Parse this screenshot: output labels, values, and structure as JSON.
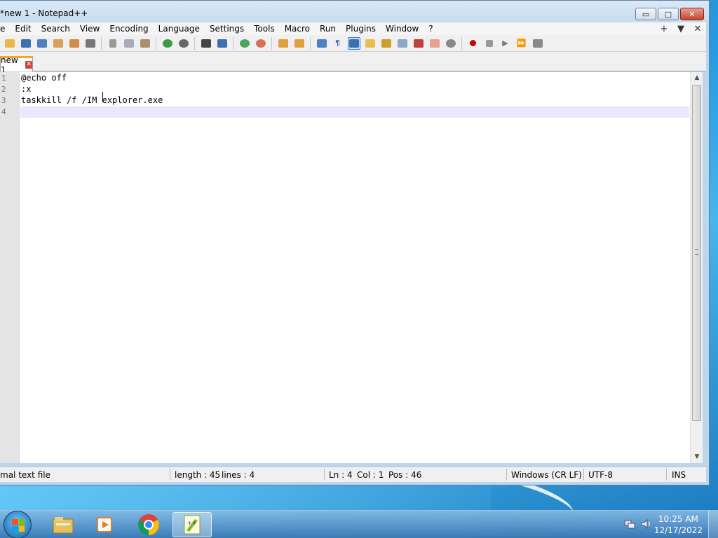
{
  "window": {
    "title": "*new 1 - Notepad++",
    "controls": {
      "minimize": "▭",
      "maximize": "□",
      "close": "✕"
    }
  },
  "menubar": {
    "items": [
      "e",
      "Edit",
      "Search",
      "View",
      "Encoding",
      "Language",
      "Settings",
      "Tools",
      "Macro",
      "Run",
      "Plugins",
      "Window",
      "?"
    ],
    "right": {
      "add": "+",
      "dropdown": "▼",
      "close": "✕"
    }
  },
  "toolbar": {
    "icons": [
      "open-icon",
      "save-icon",
      "save-all-icon",
      "close-icon",
      "close-all-icon",
      "print-icon",
      "cut-icon",
      "copy-icon",
      "paste-icon",
      "undo-icon",
      "redo-icon",
      "find-icon",
      "replace-icon",
      "zoom-in-icon",
      "zoom-out-icon",
      "sync-vertical-icon",
      "sync-horizontal-icon",
      "word-wrap-icon",
      "show-all-chars-icon",
      "indent-guide-icon",
      "user-lang-icon",
      "doc-map-icon",
      "function-list-icon",
      "folder-workspace-icon",
      "monitoring-icon",
      "record-macro-icon",
      "stop-record-icon",
      "play-macro-icon",
      "run-macro-multiple-icon",
      "save-macro-icon"
    ],
    "active": "indent-guide-icon"
  },
  "tab": {
    "label": "new 1",
    "close": "✕"
  },
  "editor": {
    "line_numbers": [
      "1",
      "2",
      "3",
      "4"
    ],
    "lines": [
      "@echo off",
      ":x",
      "taskkill /f /IM explorer.exe",
      ""
    ]
  },
  "statusbar": {
    "file_type": "mal text file",
    "length": "length : 45",
    "lines": "lines : 4",
    "ln": "Ln : 4",
    "col": "Col : 1",
    "pos": "Pos : 46",
    "eol": "Windows (CR LF)",
    "encoding": "UTF-8",
    "mode": "INS"
  },
  "taskbar": {
    "apps": [
      "windows-explorer-icon",
      "media-player-icon",
      "chrome-icon",
      "notepad-plus-plus-icon"
    ],
    "active_app": "notepad-plus-plus-icon",
    "clock": {
      "time": "10:25 AM",
      "date": "12/17/2022"
    }
  },
  "colors": {
    "accent_tab": "#f5a623",
    "current_line": "#e8e8ff",
    "close_button": "#c7432e"
  }
}
